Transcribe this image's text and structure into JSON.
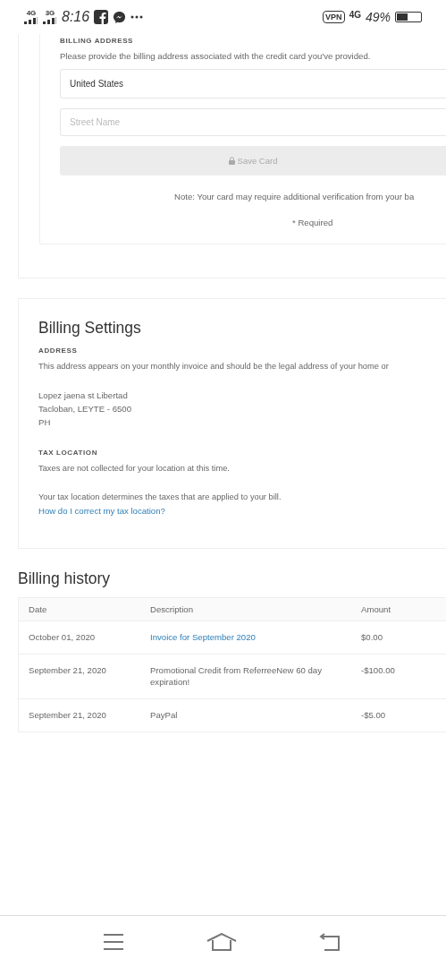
{
  "status_bar": {
    "network_1": "4G",
    "network_2": "3G",
    "time": "8:16",
    "vpn": "VPN",
    "network_3": "4G",
    "battery": "49%"
  },
  "billing_address": {
    "heading": "BILLING ADDRESS",
    "description": "Please provide the billing address associated with the credit card you've provided.",
    "country_field": {
      "value": "United States"
    },
    "street_field": {
      "placeholder": "Street Name"
    },
    "save_button": {
      "label": "Save Card",
      "disabled": true
    },
    "note": "Note: Your card may require additional verification from your ba",
    "required": "* Required"
  },
  "billing_settings": {
    "title": "Billing Settings",
    "address_heading": "ADDRESS",
    "address_description": "This address appears on your monthly invoice and should be the legal address of your home or",
    "address_lines": [
      "Lopez jaena st Libertad",
      "Tacloban, LEYTE - 6500",
      "PH"
    ],
    "tax_heading": "TAX LOCATION",
    "tax_status": "Taxes are not collected for your location at this time.",
    "tax_info": "Your tax location determines the taxes that are applied to your bill.",
    "tax_link": "How do I correct my tax location?"
  },
  "billing_history": {
    "title": "Billing history",
    "columns": [
      "Date",
      "Description",
      "Amount"
    ],
    "rows": [
      {
        "date": "October 01, 2020",
        "description": "Invoice for September 2020",
        "kind": "link",
        "amount": "$0.00"
      },
      {
        "date": "September 21, 2020",
        "description": "Promotional Credit from ReferreeNew 60 day expiration!",
        "kind": "text",
        "amount": "-$100.00"
      },
      {
        "date": "September 21, 2020",
        "description": "PayPal",
        "kind": "text",
        "amount": "-$5.00"
      }
    ]
  }
}
